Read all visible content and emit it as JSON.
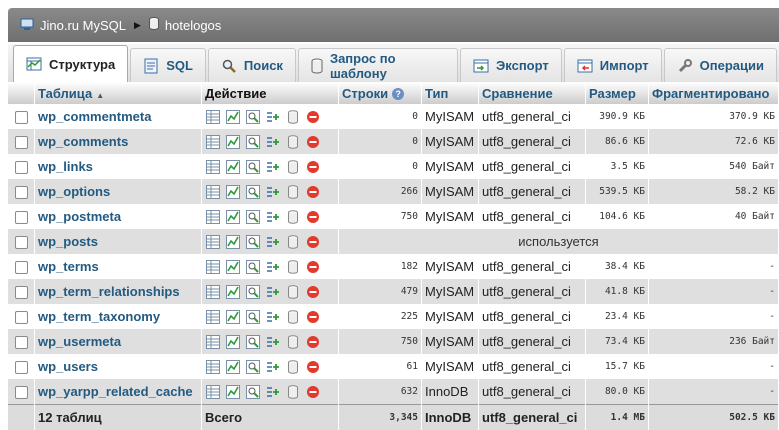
{
  "breadcrumb": {
    "server": "Jino.ru MySQL",
    "database": "hotelogos"
  },
  "tabs": [
    {
      "label": "Структура",
      "icon": "structure-icon",
      "active": true
    },
    {
      "label": "SQL",
      "icon": "sql-icon",
      "active": false
    },
    {
      "label": "Поиск",
      "icon": "search-icon",
      "active": false
    },
    {
      "label": "Запрос по шаблону",
      "icon": "query-icon",
      "active": false
    },
    {
      "label": "Экспорт",
      "icon": "export-icon",
      "active": false
    },
    {
      "label": "Импорт",
      "icon": "import-icon",
      "active": false
    },
    {
      "label": "Операции",
      "icon": "wrench-icon",
      "active": false
    }
  ],
  "columns": {
    "table": "Таблица",
    "action": "Действие",
    "rows": "Строки",
    "type": "Тип",
    "collation": "Сравнение",
    "size": "Размер",
    "overhead": "Фрагментировано"
  },
  "rows": [
    {
      "name": "wp_commentmeta",
      "rows": "0",
      "type": "MyISAM",
      "collation": "utf8_general_ci",
      "size": "390.9 КБ",
      "overhead": "370.9 КБ"
    },
    {
      "name": "wp_comments",
      "rows": "0",
      "type": "MyISAM",
      "collation": "utf8_general_ci",
      "size": "86.6 КБ",
      "overhead": "72.6 КБ"
    },
    {
      "name": "wp_links",
      "rows": "0",
      "type": "MyISAM",
      "collation": "utf8_general_ci",
      "size": "3.5 КБ",
      "overhead": "540 Байт"
    },
    {
      "name": "wp_options",
      "rows": "266",
      "type": "MyISAM",
      "collation": "utf8_general_ci",
      "size": "539.5 КБ",
      "overhead": "58.2 КБ"
    },
    {
      "name": "wp_postmeta",
      "rows": "750",
      "type": "MyISAM",
      "collation": "utf8_general_ci",
      "size": "104.6 КБ",
      "overhead": "40 Байт"
    },
    {
      "name": "wp_posts",
      "in_use": "используется"
    },
    {
      "name": "wp_terms",
      "rows": "182",
      "type": "MyISAM",
      "collation": "utf8_general_ci",
      "size": "38.4 КБ",
      "overhead": "-"
    },
    {
      "name": "wp_term_relationships",
      "rows": "479",
      "type": "MyISAM",
      "collation": "utf8_general_ci",
      "size": "41.8 КБ",
      "overhead": "-"
    },
    {
      "name": "wp_term_taxonomy",
      "rows": "225",
      "type": "MyISAM",
      "collation": "utf8_general_ci",
      "size": "23.4 КБ",
      "overhead": "-"
    },
    {
      "name": "wp_usermeta",
      "rows": "750",
      "type": "MyISAM",
      "collation": "utf8_general_ci",
      "size": "73.4 КБ",
      "overhead": "236 Байт"
    },
    {
      "name": "wp_users",
      "rows": "61",
      "type": "MyISAM",
      "collation": "utf8_general_ci",
      "size": "15.7 КБ",
      "overhead": "-"
    },
    {
      "name": "wp_yarpp_related_cache",
      "rows": "632",
      "type": "InnoDB",
      "collation": "utf8_general_ci",
      "size": "80.0 КБ",
      "overhead": "-"
    }
  ],
  "footer": {
    "count": "12 таблиц",
    "total_label": "Всего",
    "rows": "3,345",
    "type": "InnoDB",
    "collation": "utf8_general_ci",
    "size": "1.4 МБ",
    "overhead": "502.5 КБ"
  },
  "colors": {
    "link": "#235a81",
    "drop": "#e23a2d",
    "header_bar": "#7a7a7a",
    "row_alt": "#dfdfdf"
  }
}
